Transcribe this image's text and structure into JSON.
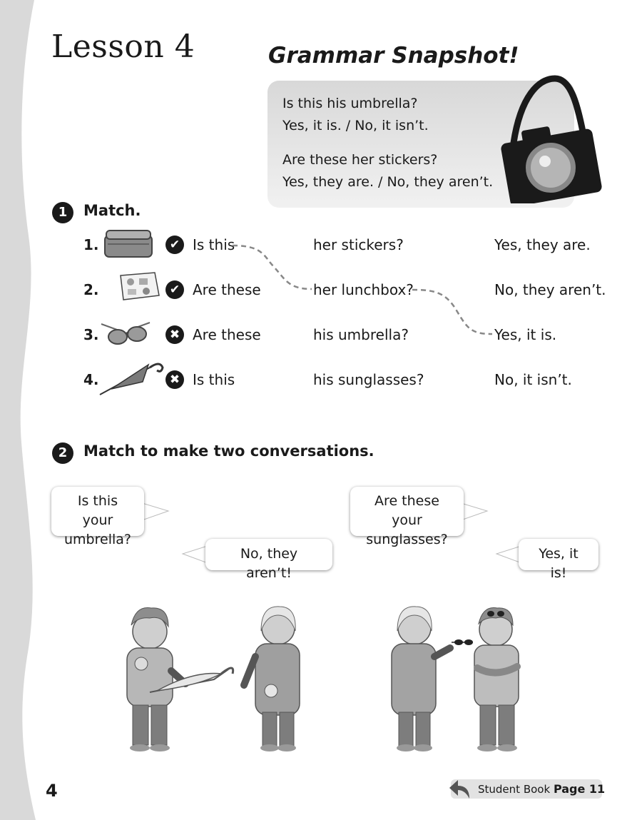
{
  "lesson_title": "Lesson 4",
  "grammar_snapshot": {
    "title": "Grammar Snapshot!",
    "lines": [
      "Is this his umbrella?",
      "Yes, it is. / No, it isn’t.",
      "Are these her stickers?",
      "Yes, they are. / No, they aren’t."
    ]
  },
  "exercise1": {
    "number": "1",
    "title": "Match.",
    "rows": [
      {
        "num": "1.",
        "image": "lunchbox",
        "mark": "✔",
        "mark_icon": "check-icon",
        "col1": "Is this",
        "col2": "her stickers?",
        "col3": "Yes, they are."
      },
      {
        "num": "2.",
        "image": "stickers",
        "mark": "✔",
        "mark_icon": "check-icon",
        "col1": "Are these",
        "col2": "her lunchbox?",
        "col3": "No, they aren’t."
      },
      {
        "num": "3.",
        "image": "sunglasses",
        "mark": "✖",
        "mark_icon": "cross-icon",
        "col1": "Are these",
        "col2": "his umbrella?",
        "col3": "Yes, it is."
      },
      {
        "num": "4.",
        "image": "umbrella",
        "mark": "✖",
        "mark_icon": "cross-icon",
        "col1": "Is this",
        "col2": "his sunglasses?",
        "col3": "No, it isn’t."
      }
    ]
  },
  "exercise2": {
    "number": "2",
    "title": "Match to make two conversations.",
    "bubbles": [
      {
        "lines": [
          "Is this your",
          "umbrella?"
        ]
      },
      {
        "lines": [
          "No, they aren’t!"
        ]
      },
      {
        "lines": [
          "Are these your",
          "sunglasses?"
        ]
      },
      {
        "lines": [
          "Yes, it is!"
        ]
      }
    ]
  },
  "footer": {
    "page_number": "4",
    "student_book_label": "Student Book",
    "student_book_page": "Page 11"
  },
  "colors": {
    "ink": "#1a1a1a",
    "wave_grey": "#d9d9d9",
    "box_grey": "#e0e0e0"
  }
}
